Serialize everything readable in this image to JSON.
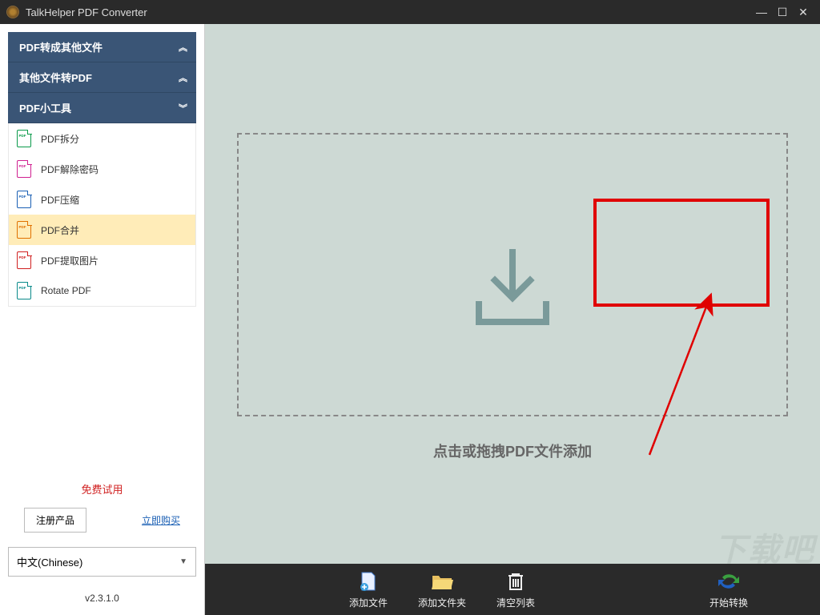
{
  "titlebar": {
    "title": "TalkHelper PDF Converter"
  },
  "sidebar": {
    "categories": [
      {
        "label": "PDF转成其他文件",
        "expanded": false
      },
      {
        "label": "其他文件转PDF",
        "expanded": false
      },
      {
        "label": "PDF小工具",
        "expanded": true
      }
    ],
    "tools": [
      {
        "label": "PDF拆分",
        "color": "green"
      },
      {
        "label": "PDF解除密码",
        "color": "magenta"
      },
      {
        "label": "PDF压缩",
        "color": "blue"
      },
      {
        "label": "PDF合并",
        "color": "orange",
        "selected": true
      },
      {
        "label": "PDF提取图片",
        "color": "red"
      },
      {
        "label": "Rotate PDF",
        "color": "teal"
      }
    ],
    "trial_text": "免费试用",
    "register_button": "注册产品",
    "buy_link": "立即购买",
    "language_value": "中文(Chinese)",
    "version": "v2.3.1.0"
  },
  "main": {
    "drop_text": "点击或拖拽PDF文件添加"
  },
  "bottombar": {
    "add_file": "添加文件",
    "add_folder": "添加文件夹",
    "clear_list": "清空列表",
    "start_convert": "开始转换"
  },
  "watermark": "下载吧"
}
